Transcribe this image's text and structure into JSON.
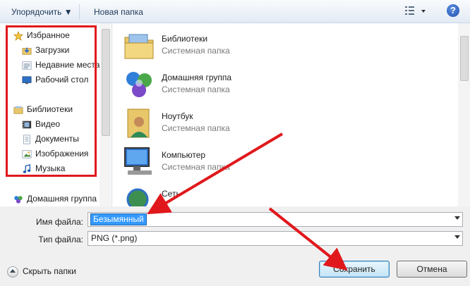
{
  "toolbar": {
    "organize_label": "Упорядочить ▼",
    "new_folder_label": "Новая папка",
    "view_icon": "view-options-icon",
    "help_label": "?"
  },
  "sidebar": {
    "favorites_label": "Избранное",
    "downloads_label": "Загрузки",
    "recent_label": "Недавние места",
    "desktop_label": "Рабочий стол",
    "libraries_label": "Библиотеки",
    "video_label": "Видео",
    "documents_label": "Документы",
    "images_label": "Изображения",
    "music_label": "Музыка",
    "homegroup_label": "Домашняя группа"
  },
  "content": {
    "items": [
      {
        "name": "Библиотеки",
        "type": "Системная папка"
      },
      {
        "name": "Домашняя группа",
        "type": "Системная папка"
      },
      {
        "name": "Ноутбук",
        "type": "Системная папка"
      },
      {
        "name": "Компьютер",
        "type": "Системная папка"
      },
      {
        "name": "Сеть",
        "type": ""
      }
    ]
  },
  "form": {
    "filename_label": "Имя файла:",
    "filename_value": "Безымянный",
    "filetype_label": "Тип файла:",
    "filetype_value": "PNG (*.png)"
  },
  "footer": {
    "hide_folders_label": "Скрыть папки",
    "save_label": "Сохранить",
    "cancel_label": "Отмена"
  },
  "colors": {
    "annotation": "#e0181c",
    "selection": "#3399ff",
    "toolbar_text": "#1e395b"
  }
}
